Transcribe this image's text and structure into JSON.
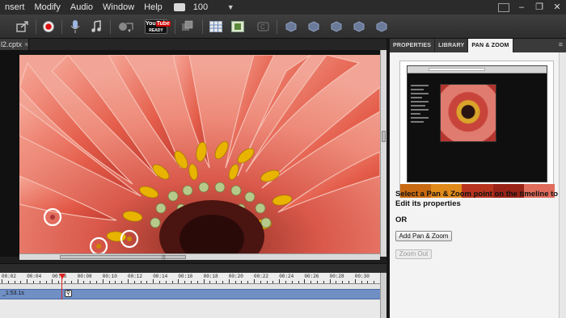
{
  "menu": {
    "items": [
      "nsert",
      "Modify",
      "Audio",
      "Window",
      "Help"
    ],
    "zoom_value": "100"
  },
  "document": {
    "tab_label": "l2.cptx",
    "close_glyph": "×"
  },
  "toolbar": {
    "youtube_label_top": "You",
    "youtube_label_mid": "Tube",
    "youtube_label_bottom": "READY"
  },
  "timeline": {
    "ticks": [
      "00:02",
      "00:04",
      "00:06",
      "00:08",
      "00:10",
      "00:12",
      "00:14",
      "00:16",
      "00:18",
      "00:20",
      "00:22",
      "00:24",
      "00:26",
      "00:28",
      "00:30"
    ],
    "track_label": "_1:53.1s",
    "marker_glyph": "⚲"
  },
  "panel": {
    "tabs": [
      "PROPERTIES",
      "LIBRARY",
      "PAN & ZOOM"
    ],
    "active_tab": "PAN & ZOOM",
    "instructions": "Select a Pan & Zoom point on the timeline to Edit its properties",
    "or_label": "OR",
    "add_button": "Add Pan & Zoom",
    "zoom_out_button": "Zoom Out"
  },
  "colors": {
    "accent_red": "#cc0000",
    "track_blue": "#6f8fc5",
    "petal": "#e06a5a",
    "stamen": "#e8b400"
  }
}
